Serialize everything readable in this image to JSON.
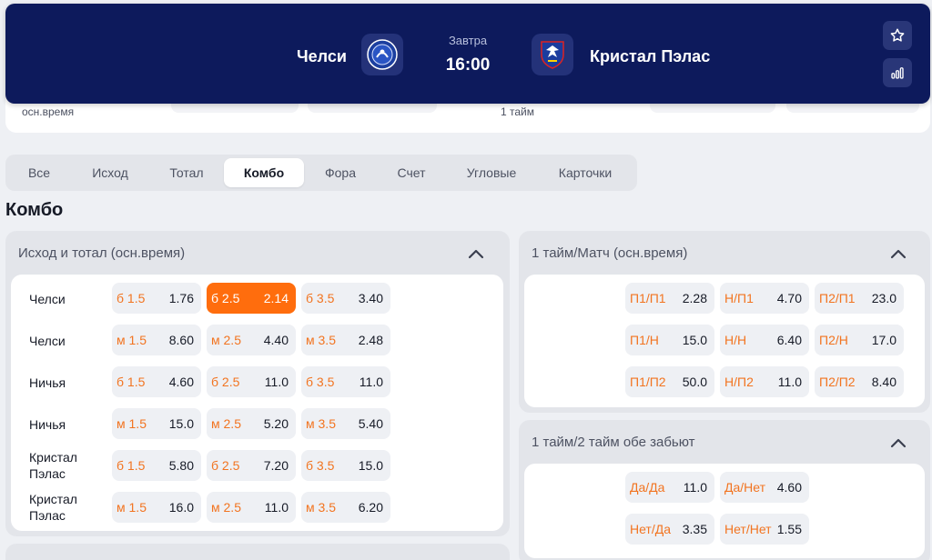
{
  "header": {
    "home_team": "Челси",
    "away_team": "Кристал Пэлас",
    "day": "Завтра",
    "time": "16:00"
  },
  "strip": {
    "left_label": "осн.время",
    "center_label": "1 тайм"
  },
  "tabs": [
    {
      "label": "Все"
    },
    {
      "label": "Исход"
    },
    {
      "label": "Тотал"
    },
    {
      "label": "Комбо",
      "active": true
    },
    {
      "label": "Фора"
    },
    {
      "label": "Счет"
    },
    {
      "label": "Угловые"
    },
    {
      "label": "Карточки"
    }
  ],
  "section_title": "Комбо",
  "panels": {
    "outcome_total": {
      "title": "Исход и тотал (осн.время)",
      "rows": [
        {
          "label": "Челси",
          "cells": [
            {
              "sel": "б 1.5",
              "odd": "1.76"
            },
            {
              "sel": "б 2.5",
              "odd": "2.14",
              "selected": true
            },
            {
              "sel": "б 3.5",
              "odd": "3.40"
            }
          ]
        },
        {
          "label": "Челси",
          "cells": [
            {
              "sel": "м 1.5",
              "odd": "8.60"
            },
            {
              "sel": "м 2.5",
              "odd": "4.40"
            },
            {
              "sel": "м 3.5",
              "odd": "2.48"
            }
          ]
        },
        {
          "label": "Ничья",
          "cells": [
            {
              "sel": "б 1.5",
              "odd": "4.60"
            },
            {
              "sel": "б 2.5",
              "odd": "11.0"
            },
            {
              "sel": "б 3.5",
              "odd": "11.0"
            }
          ]
        },
        {
          "label": "Ничья",
          "cells": [
            {
              "sel": "м 1.5",
              "odd": "15.0"
            },
            {
              "sel": "м 2.5",
              "odd": "5.20"
            },
            {
              "sel": "м 3.5",
              "odd": "5.40"
            }
          ]
        },
        {
          "label_line1": "Кристал",
          "label_line2": "Пэлас",
          "cells": [
            {
              "sel": "б 1.5",
              "odd": "5.80"
            },
            {
              "sel": "б 2.5",
              "odd": "7.20"
            },
            {
              "sel": "б 3.5",
              "odd": "15.0"
            }
          ]
        },
        {
          "label_line1": "Кристал",
          "label_line2": "Пэлас",
          "cells": [
            {
              "sel": "м 1.5",
              "odd": "16.0"
            },
            {
              "sel": "м 2.5",
              "odd": "11.0"
            },
            {
              "sel": "м 3.5",
              "odd": "6.20"
            }
          ]
        }
      ]
    },
    "ht_ft": {
      "title": "1 тайм/Матч (осн.время)",
      "rows": [
        [
          {
            "sel": "П1/П1",
            "odd": "2.28"
          },
          {
            "sel": "Н/П1",
            "odd": "4.70"
          },
          {
            "sel": "П2/П1",
            "odd": "23.0"
          }
        ],
        [
          {
            "sel": "П1/Н",
            "odd": "15.0"
          },
          {
            "sel": "Н/Н",
            "odd": "6.40"
          },
          {
            "sel": "П2/Н",
            "odd": "17.0"
          }
        ],
        [
          {
            "sel": "П1/П2",
            "odd": "50.0"
          },
          {
            "sel": "Н/П2",
            "odd": "11.0"
          },
          {
            "sel": "П2/П2",
            "odd": "8.40"
          }
        ]
      ]
    },
    "both_score": {
      "title": "1 тайм/2 тайм обе забьют",
      "rows": [
        [
          {
            "sel": "Да/Да",
            "odd": "11.0"
          },
          {
            "sel": "Да/Нет",
            "odd": "4.60"
          }
        ],
        [
          {
            "sel": "Нет/Да",
            "odd": "3.35"
          },
          {
            "sel": "Нет/Нет",
            "odd": "1.55"
          }
        ]
      ]
    }
  },
  "colors": {
    "header_bg": "#0d1a5c",
    "accent": "#ff6d0d",
    "selection_text": "#f27420"
  },
  "icons": [
    "chelsea-logo-icon",
    "crystal-palace-logo-icon",
    "star-icon",
    "stats-icon",
    "chevron-up-icon"
  ]
}
